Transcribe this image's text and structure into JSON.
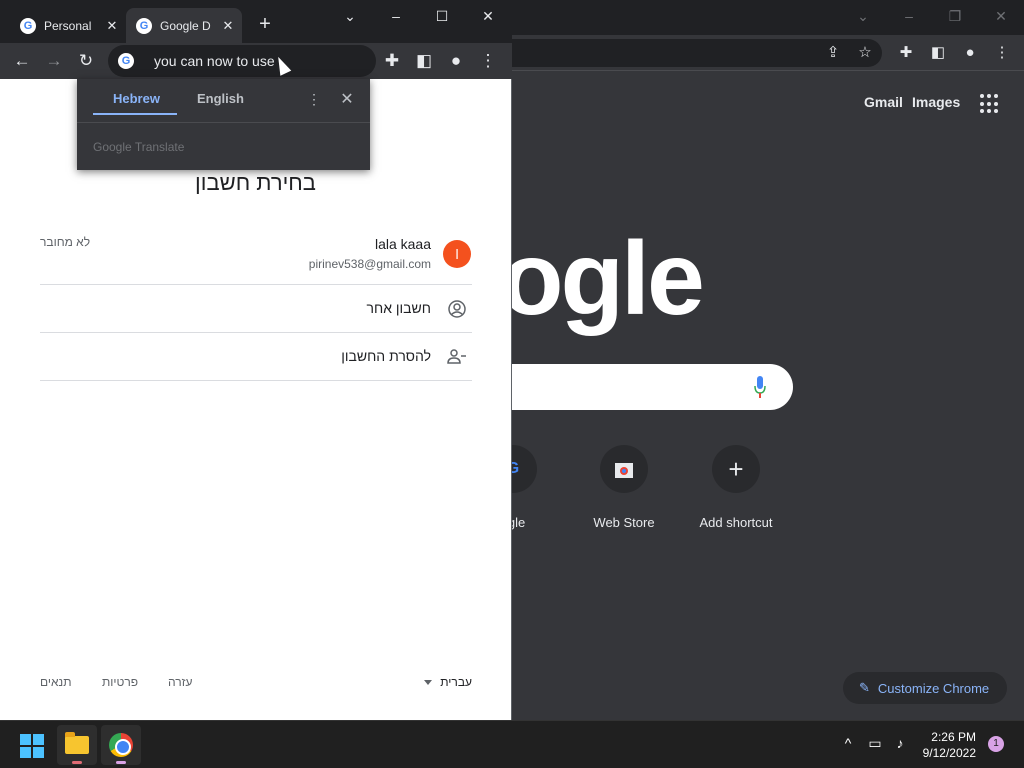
{
  "background_window": {
    "ntp_links": [
      "Gmail",
      "Images"
    ],
    "logo_partial": "ogle",
    "shortcuts": [
      {
        "label": "ogle",
        "icon": "google-icon"
      },
      {
        "label": "Web Store",
        "icon": "web-store-icon"
      },
      {
        "label": "Add shortcut",
        "icon": "plus-icon"
      }
    ],
    "customize_label": "Customize Chrome"
  },
  "foreground_window": {
    "tabs": [
      {
        "title": "Personal",
        "active": false
      },
      {
        "title": "Google D",
        "active": true
      }
    ],
    "omnibox_text": "you can now to use",
    "translate_popup": {
      "source_lang": "Hebrew",
      "target_lang": "English",
      "brand": "Google Translate"
    },
    "page": {
      "title": "בחירת חשבון",
      "account": {
        "status": "לא מחובר",
        "name": "lala kaaa",
        "email": "pirinev538@gmail.com",
        "initial": "l",
        "avatar_color": "#f4511e"
      },
      "other_account_label": "חשבון אחר",
      "remove_account_label": "להסרת החשבון",
      "footer": {
        "language": "עברית",
        "help": "עזרה",
        "privacy": "פרטיות",
        "terms": "תנאים"
      }
    }
  },
  "taskbar": {
    "time": "2:26 PM",
    "date": "9/12/2022",
    "notification_count": "1"
  },
  "colors": {
    "accent": "#8ab4f8",
    "chrome_dark": "#35363a",
    "titlebar": "#202124"
  }
}
